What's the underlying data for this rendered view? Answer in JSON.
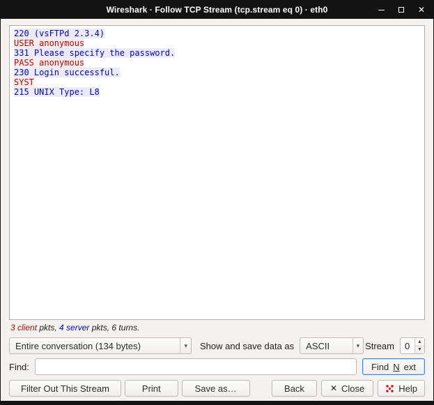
{
  "colors": {
    "client_text": "#9e0b0b",
    "client_bg": "#fdeaea",
    "server_text": "#06069e",
    "server_bg": "#eaeafa",
    "accent": "#3584e4",
    "titlebar_bg": "#131313"
  },
  "window": {
    "title": "Wireshark · Follow TCP Stream (tcp.stream eq 0) · eth0"
  },
  "icons": {
    "close_glyph": "✕",
    "dropdown_arrow": "▾",
    "spinner_up": "▲",
    "spinner_down": "▼",
    "titlebar_close": "✕"
  },
  "stream": {
    "lines": [
      {
        "text": "220 (vsFTPd 2.3.4)",
        "direction": "server"
      },
      {
        "text": "USER anonymous",
        "direction": "client"
      },
      {
        "text": "331 Please specify the password.",
        "direction": "server"
      },
      {
        "text": "PASS anonymous",
        "direction": "client"
      },
      {
        "text": "230 Login successful.",
        "direction": "server"
      },
      {
        "text": "SYST",
        "direction": "client"
      },
      {
        "text": "215 UNIX Type: L8",
        "direction": "server"
      }
    ]
  },
  "stats": {
    "segments": [
      {
        "text": "3 client",
        "role": "client"
      },
      {
        "text": " pkts, ",
        "role": "plain"
      },
      {
        "text": "4 server",
        "role": "server"
      },
      {
        "text": " pkts, ",
        "role": "plain"
      },
      {
        "text": "6 turns.",
        "role": "plain"
      }
    ]
  },
  "controls": {
    "conversation_select": "Entire conversation (134 bytes)",
    "show_save_label": "Show and save data as",
    "format_select": "ASCII",
    "stream_label": "Stream",
    "stream_value": "0",
    "find_label": "Find:",
    "find_value": "",
    "find_next": {
      "pre": "Find ",
      "mnemonic": "N",
      "post": "ext"
    }
  },
  "buttons": {
    "filter_out": "Filter Out This Stream",
    "print": "Print",
    "save_as": "Save as…",
    "back": "Back",
    "close": "Close",
    "help": "Help"
  }
}
